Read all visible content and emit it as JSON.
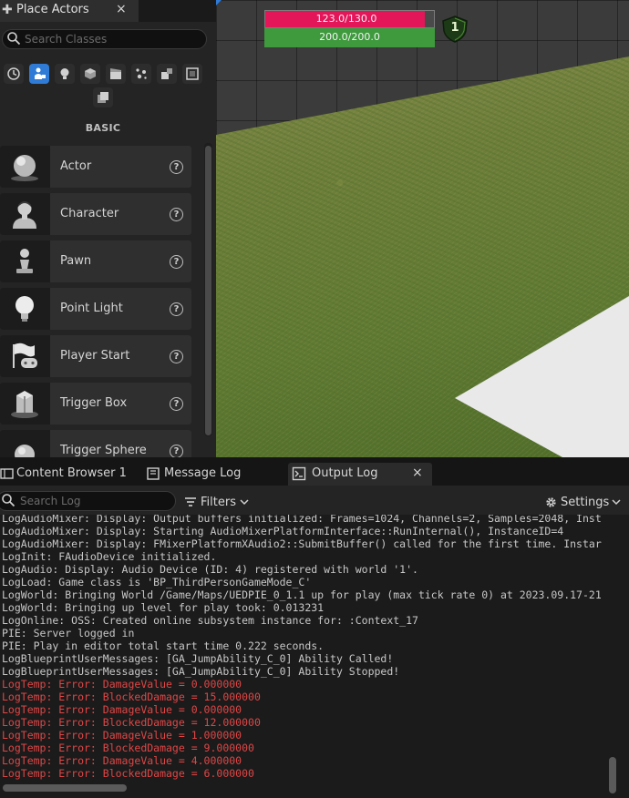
{
  "place_actors": {
    "tab_title": "Place Actors",
    "close_glyph": "×",
    "search_placeholder": "Search Classes",
    "categories": [
      {
        "icon": "recently-placed-icon",
        "active": false
      },
      {
        "icon": "basic-icon",
        "active": true
      },
      {
        "icon": "lights-icon",
        "active": false
      },
      {
        "icon": "shapes-icon",
        "active": false
      },
      {
        "icon": "cinematic-icon",
        "active": false
      },
      {
        "icon": "visual-effects-icon",
        "active": false
      },
      {
        "icon": "geometry-icon",
        "active": false
      },
      {
        "icon": "volumes-icon",
        "active": false
      },
      {
        "icon": "all-classes-icon",
        "active": false
      }
    ],
    "section_heading": "BASIC",
    "help_glyph": "?",
    "items": [
      {
        "label": "Actor",
        "icon": "actor-sphere-icon"
      },
      {
        "label": "Character",
        "icon": "character-icon"
      },
      {
        "label": "Pawn",
        "icon": "pawn-icon"
      },
      {
        "label": "Point Light",
        "icon": "point-light-icon"
      },
      {
        "label": "Player Start",
        "icon": "player-start-icon"
      },
      {
        "label": "Trigger Box",
        "icon": "trigger-box-icon"
      },
      {
        "label": "Trigger Sphere",
        "icon": "trigger-sphere-icon"
      }
    ]
  },
  "hud": {
    "health": {
      "text": "123.0/130.0",
      "fraction": 0.946,
      "color": "#e3165a"
    },
    "stamina": {
      "text": "200.0/200.0",
      "fraction": 1.0,
      "color": "#3e9a3d"
    },
    "level": "1"
  },
  "bottom_tabs": [
    {
      "label": "Content Browser 1",
      "icon": "content-browser-icon"
    },
    {
      "label": "Message Log",
      "icon": "message-log-icon"
    },
    {
      "label": "Output Log",
      "icon": "output-log-icon",
      "active": true
    }
  ],
  "output_close_glyph": "×",
  "log_toolbar": {
    "search_placeholder": "Search Log",
    "filters_label": "Filters",
    "settings_label": "Settings"
  },
  "log_lines": [
    {
      "text": "LogAudioMixer: Display: Output buffers initialized: Frames=1024, Channels=2, Samples=2048, Inst",
      "level": "info"
    },
    {
      "text": "LogAudioMixer: Display: Starting AudioMixerPlatformInterface::RunInternal(), InstanceID=4",
      "level": "info"
    },
    {
      "text": "LogAudioMixer: Display: FMixerPlatformXAudio2::SubmitBuffer() called for the first time. Instar",
      "level": "info"
    },
    {
      "text": "LogInit: FAudioDevice initialized.",
      "level": "info"
    },
    {
      "text": "LogAudio: Display: Audio Device (ID: 4) registered with world '1'.",
      "level": "info"
    },
    {
      "text": "LogLoad: Game class is 'BP_ThirdPersonGameMode_C'",
      "level": "info"
    },
    {
      "text": "LogWorld: Bringing World /Game/Maps/UEDPIE_0_1.1 up for play (max tick rate 0) at 2023.09.17-21",
      "level": "info"
    },
    {
      "text": "LogWorld: Bringing up level for play took: 0.013231",
      "level": "info"
    },
    {
      "text": "LogOnline: OSS: Created online subsystem instance for: :Context_17",
      "level": "info"
    },
    {
      "text": "PIE: Server logged in",
      "level": "info"
    },
    {
      "text": "PIE: Play in editor total start time 0.222 seconds.",
      "level": "info"
    },
    {
      "text": "LogBlueprintUserMessages: [GA_JumpAbility_C_0] Ability Called!",
      "level": "info"
    },
    {
      "text": "LogBlueprintUserMessages: [GA_JumpAbility_C_0] Ability Stopped!",
      "level": "info"
    },
    {
      "text": "LogTemp: Error: DamageValue = 0.000000",
      "level": "error"
    },
    {
      "text": "LogTemp: Error: BlockedDamage = 15.000000",
      "level": "error"
    },
    {
      "text": "LogTemp: Error: DamageValue = 0.000000",
      "level": "error"
    },
    {
      "text": "LogTemp: Error: BlockedDamage = 12.000000",
      "level": "error"
    },
    {
      "text": "LogTemp: Error: DamageValue = 1.000000",
      "level": "error"
    },
    {
      "text": "LogTemp: Error: BlockedDamage = 9.000000",
      "level": "error"
    },
    {
      "text": "LogTemp: Error: DamageValue = 4.000000",
      "level": "error"
    },
    {
      "text": "LogTemp: Error: BlockedDamage = 6.000000",
      "level": "error"
    }
  ]
}
